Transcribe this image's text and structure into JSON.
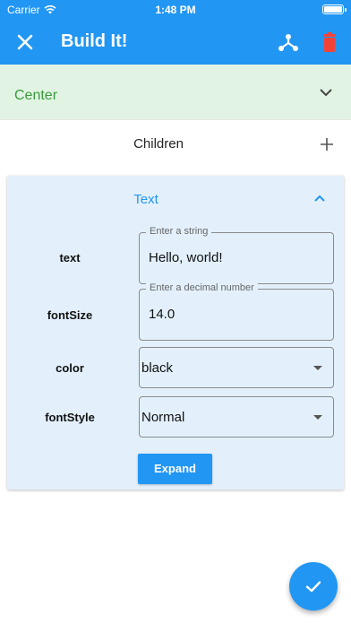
{
  "status_bar": {
    "carrier": "Carrier",
    "time": "1:48 PM"
  },
  "app_bar": {
    "title": "Build It!"
  },
  "widget_tree": {
    "center_label": "Center",
    "children_label": "Children",
    "text_card": {
      "header": "Text",
      "fields": [
        {
          "label": "text",
          "hint": "Enter a string",
          "value": "Hello, world!"
        },
        {
          "label": "fontSize",
          "hint": "Enter a decimal number",
          "value": "14.0"
        }
      ],
      "selects": [
        {
          "label": "color",
          "value": "black"
        },
        {
          "label": "fontStyle",
          "value": "Normal"
        }
      ],
      "expand_label": "Expand"
    }
  },
  "colors": {
    "primary": "#2196f3",
    "center_bg": "#e1f4e3",
    "center_text": "#3a9a3e",
    "card_bg": "#e3f0fc",
    "delete": "#f44336"
  }
}
